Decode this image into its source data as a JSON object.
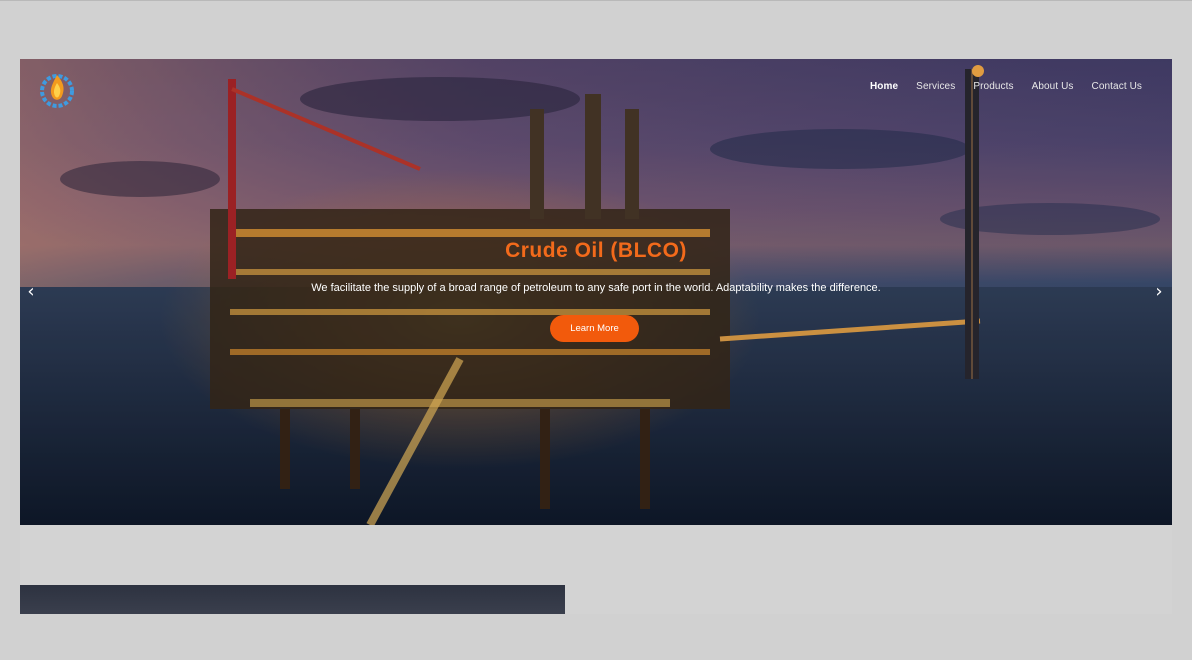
{
  "nav": {
    "items": [
      {
        "label": "Home",
        "active": true
      },
      {
        "label": "Services",
        "active": false
      },
      {
        "label": "Products",
        "active": false
      },
      {
        "label": "About Us",
        "active": false
      },
      {
        "label": "Contact Us",
        "active": false
      }
    ]
  },
  "hero": {
    "title": "Crude Oil (BLCO)",
    "subtitle": "We facilitate the supply of a broad range of petroleum to any safe port in the world. Adaptability makes the difference.",
    "button_label": "Learn More",
    "prev_icon": "chevron-left-icon",
    "next_icon": "chevron-right-icon"
  },
  "logo": {
    "icon": "flame-gear-logo-icon"
  },
  "colors": {
    "accent": "#f25a0c",
    "title": "#f26a1b",
    "background": "#d1d1d1"
  }
}
